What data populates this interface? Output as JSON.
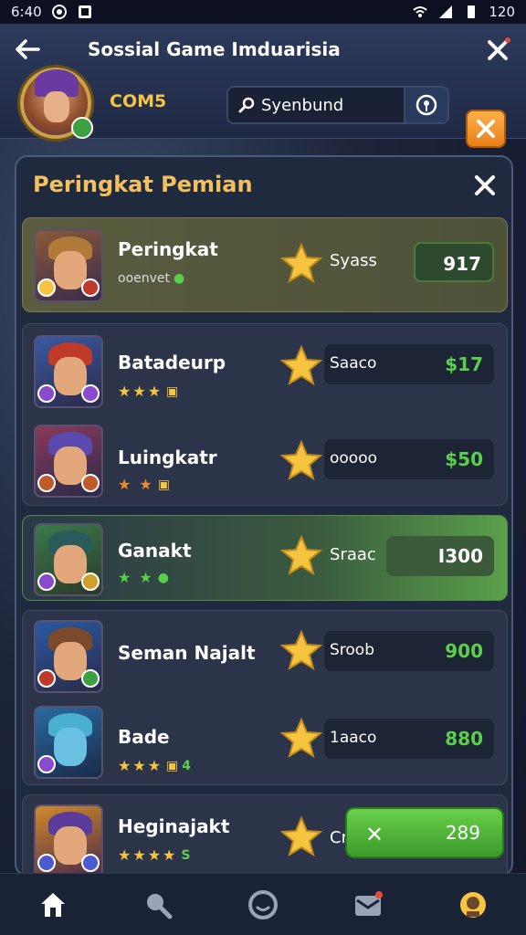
{
  "statusbar": {
    "time": "6:40",
    "battery": "120"
  },
  "header": {
    "title": "Sossial Game Imduarisia",
    "username": "COM5",
    "search_value": "Syenbund"
  },
  "panel": {
    "title": "Peringkat Pemian",
    "rows": [
      {
        "name": "Peringkat",
        "sub": "ooenvet",
        "label": "Syass",
        "score": "917",
        "stars": ""
      },
      {
        "name": "Batadeurp",
        "sub": "",
        "label": "Saaco",
        "score": "$17",
        "stars": "★★★"
      },
      {
        "name": "Luingkatr",
        "sub": "",
        "label": "ooooo",
        "score": "$50",
        "stars": "★ ★"
      },
      {
        "name": "Ganakt",
        "sub": "",
        "label": "Sraac",
        "score": "I300",
        "stars": "★ ★"
      },
      {
        "name": "Seman Najalt",
        "sub": "",
        "label": "Sroob",
        "score": "900",
        "stars": ""
      },
      {
        "name": "Bade",
        "sub": "4",
        "label": "1aaco",
        "score": "880",
        "stars": "★★★"
      },
      {
        "name": "Heginajakt",
        "sub": "S",
        "label": "Cr",
        "score": "",
        "stars": "★★★★"
      }
    ]
  },
  "claim": {
    "value": "289"
  },
  "colors": {
    "accent": "#f5c542",
    "green": "#5ad04a",
    "orange": "#e8801a"
  }
}
